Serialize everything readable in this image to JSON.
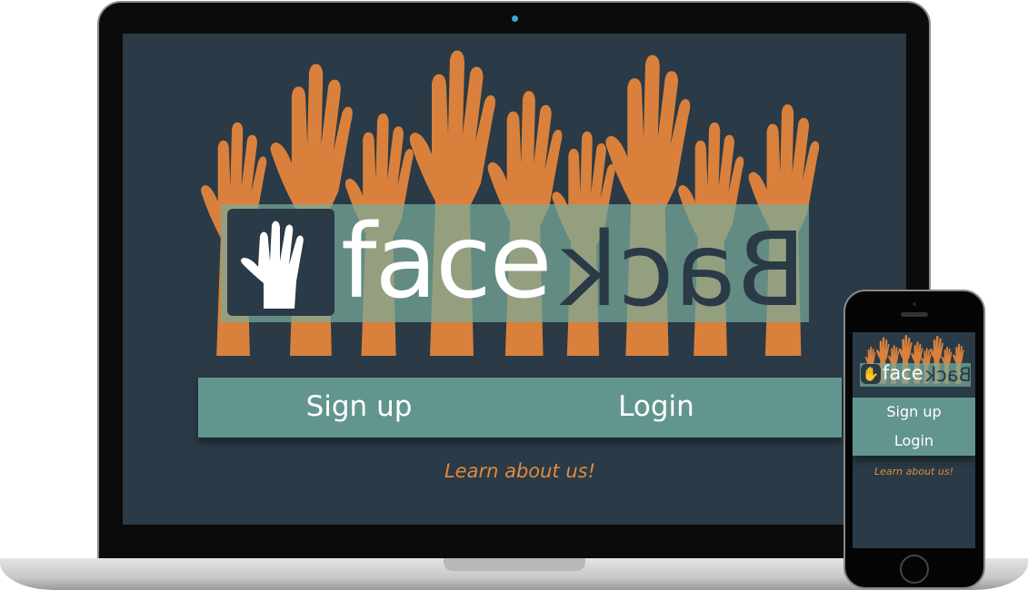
{
  "app": {
    "logo_face": "face",
    "logo_back": "Back"
  },
  "desktop": {
    "signup_label": "Sign up",
    "login_label": "Login",
    "learn_label": "Learn about us!"
  },
  "mobile": {
    "signup_label": "Sign up",
    "login_label": "Login",
    "learn_label": "Learn about us!"
  },
  "colors": {
    "background": "#2a3a46",
    "accent": "#e08a3c",
    "button_bar": "#63958f"
  }
}
